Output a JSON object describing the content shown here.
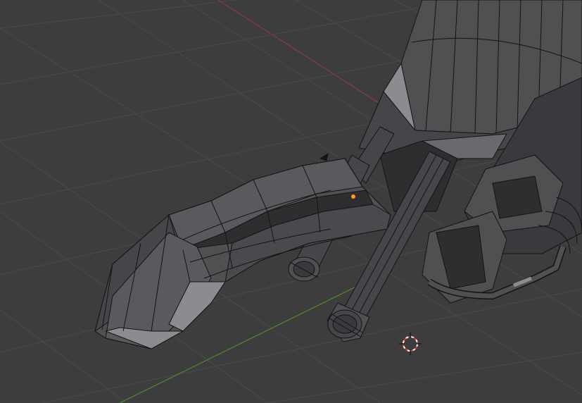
{
  "viewport": {
    "background_color": "#3d3d3d",
    "grid_color": "#4a4a4a",
    "x_axis_color": "#8a3d3d",
    "y_axis_color": "#4f8a2e",
    "mesh_face_color": "#505052",
    "mesh_dark_color": "#2e2e31",
    "mesh_light_color": "#8c8c90",
    "edge_color": "#141414",
    "origin_color": "#ff9a1f",
    "cursor_colors": [
      "#e03030",
      "#ffffff"
    ]
  },
  "scene": {
    "icons": [
      "3d-cursor-icon",
      "object-origin-icon"
    ]
  }
}
